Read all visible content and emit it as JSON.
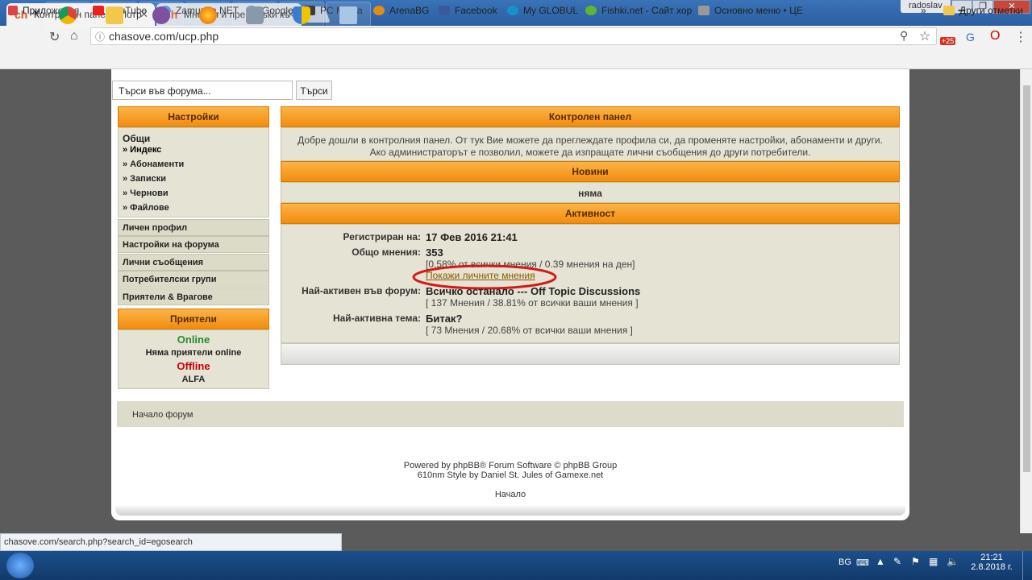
{
  "browser": {
    "tabs": [
      {
        "title": "Контролен панел • Потр",
        "favicon": "ch"
      },
      {
        "title": "Мнения и препоръки къ",
        "favicon": "ch"
      }
    ],
    "user": "radoslav",
    "url": "chasove.com/ucp.php",
    "bookmarks": [
      "Приложения",
      "YouTube",
      "Zamunda.NET",
      "Google",
      "PC Mania",
      "ArenaBG",
      "Facebook",
      "My GLOBUL",
      "Fishki.net - Сайт хор",
      "Основно меню • ЦЕ"
    ],
    "bookmarks_other": "Други отметки",
    "badge": "+25"
  },
  "page": {
    "search_placeholder": "Търси във форума...",
    "search_button": "Търси",
    "sidebar": {
      "settings_header": "Настройки",
      "general": "Общи",
      "sub_items": [
        "» Индекс",
        "» Абонаменти",
        "» Записки",
        "» Чернови",
        "» Файлове"
      ],
      "items": [
        "Личен профил",
        "Настройки на форума",
        "Лични съобщения",
        "Потребителски групи",
        "Приятели & Врагове"
      ],
      "friends_header": "Приятели",
      "online": "Online",
      "no_friends": "Няма приятели online",
      "offline": "Offline",
      "offline_user": "ALFA"
    },
    "main": {
      "cp_header": "Контролен панел",
      "welcome": "Добре дошли в контролния панел. От тук Вие можете да преглеждате профила си, да променяте настройки, абонаменти и други. Ако администраторът е позволил, можете да изпращате лични съобщения до други потребители.",
      "news_header": "Новини",
      "news_none": "няма",
      "activity_header": "Активност",
      "registered_label": "Регистриран на:",
      "registered_value": "17 Фев 2016 21:41",
      "posts_label": "Общо мнения:",
      "posts_value": "353",
      "posts_note": "[0.58% от всички мнения / 0.39 мнения на ден]",
      "show_posts_link": "Покажи личните мнения",
      "active_forum_label": "Най-активен във форум:",
      "active_forum_value": "Всичко останало --- Off Topic Discussions",
      "active_forum_note": "[ 137 Мнения / 38.81% от всички ваши мнения ]",
      "active_topic_label": "Най-активна тема:",
      "active_topic_value": "Битак?",
      "active_topic_note": "[ 73 Мнения / 20.68% от всички ваши мнения ]"
    },
    "footer_link": "Начало форум",
    "powered1": "Powered by phpBB® Forum Software © phpBB Group",
    "powered2": "610nm Style by Daniel St. Jules of Gamexe.net",
    "home": "Начало"
  },
  "status_url": "chasove.com/search.php?search_id=egosearch",
  "taskbar": {
    "lang": "BG",
    "time": "21:21",
    "date": "2.8.2018 г."
  },
  "colors": {
    "header_orange": "#f28c0d",
    "panel": "#e4e3d4",
    "online": "#2a8a2a",
    "offline": "#d00000"
  }
}
